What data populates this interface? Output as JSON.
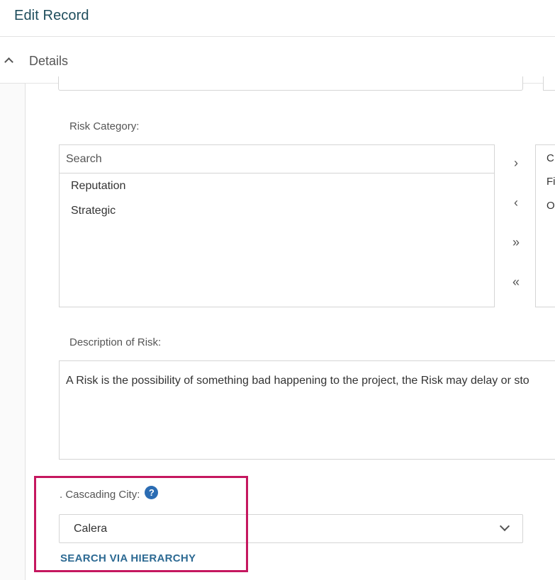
{
  "header": {
    "title": "Edit Record"
  },
  "section": {
    "title": "Details",
    "toggle_icon": "chevron-up-icon"
  },
  "risk_category": {
    "label": "Risk Category:",
    "search_placeholder": "Search",
    "available_items": [
      "Reputation",
      "Strategic"
    ],
    "move_buttons": {
      "add": "›",
      "remove": "‹",
      "add_all": "»",
      "remove_all": "«"
    },
    "selected_items_partial": [
      "C",
      "Fi",
      "O"
    ]
  },
  "description": {
    "label": "Description of Risk:",
    "value": "A Risk is the possibility of something bad happening to the project, the Risk may delay or sto"
  },
  "cascading_city": {
    "label": ". Cascading City:",
    "help_icon": "?",
    "value": "Calera",
    "dropdown_icon": "chevron-down-icon",
    "link": "SEARCH VIA HIERARCHY"
  },
  "colors": {
    "header_text": "#1e4d5c",
    "link": "#2d6a93",
    "help_icon": "#2b6cb3",
    "highlight": "#c5175f"
  }
}
